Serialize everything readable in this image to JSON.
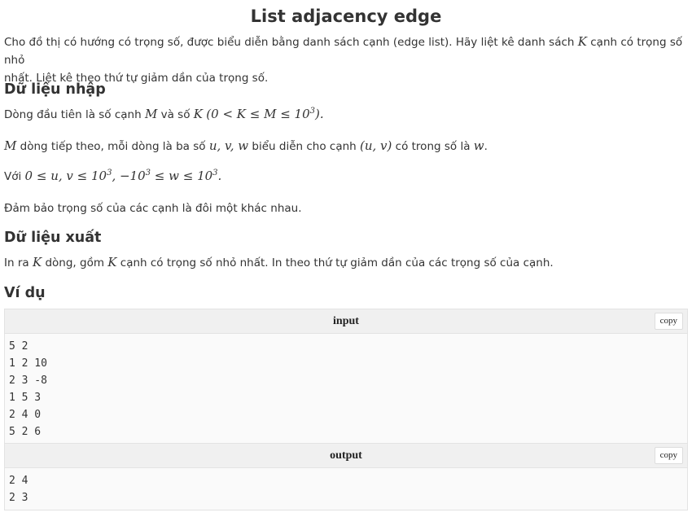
{
  "problem": {
    "title": "List adjacency edge"
  },
  "statement": {
    "line1_a": "Cho đồ thị có hướng có trọng số, được biểu diễn bằng danh sách cạnh (edge list). Hãy liệt kê danh sách ",
    "line1_var": "K",
    "line1_b": " cạnh có trọng số nhỏ",
    "line2": "nhất. Liệt kê theo thứ tự giảm dần của trọng số."
  },
  "input_section": {
    "heading": "Dữ liệu nhập",
    "p1_a": "Dòng đầu tiên là số cạnh ",
    "p1_var_m": "M",
    "p1_b": " và số ",
    "p1_math": "K",
    "p1_math_rest": "(0 < K ≤ M ≤ 10",
    "p1_exp": "3",
    "p1_end": ").",
    "p2_var": "M",
    "p2_a": " dòng tiếp theo, mỗi dòng là ba số ",
    "p2_vars": "u, v, w",
    "p2_b": " biểu diễn cho cạnh ",
    "p2_edge": "(u, v)",
    "p2_c": " có trong số là ",
    "p2_w": "w",
    "p2_end": ".",
    "p3_a": "Với ",
    "p3_math1": "0 ≤ u, v ≤ 10",
    "p3_exp1": "3",
    "p3_math2": ", −10",
    "p3_exp2": "3",
    "p3_math3": " ≤ w ≤ 10",
    "p3_exp3": "3",
    "p3_end": ".",
    "p4": "Đảm bảo trọng số của các cạnh là đôi một khác nhau."
  },
  "output_section": {
    "heading": "Dữ liệu xuất",
    "p1_a": "In ra ",
    "p1_var": "K",
    "p1_b": " dòng, gồm ",
    "p1_var2": "K",
    "p1_c": " cạnh có trọng số nhỏ nhất. In theo thứ tự giảm dần của các trọng số của cạnh."
  },
  "example": {
    "heading": "Ví dụ",
    "input_label": "input",
    "output_label": "output",
    "copy_label": "copy",
    "input_lines": [
      "5 2",
      "1 2 10",
      "2 3 -8",
      "1 5 3",
      "2 4 0",
      "5 2 6"
    ],
    "output_lines": [
      "2 4",
      "2 3"
    ]
  }
}
